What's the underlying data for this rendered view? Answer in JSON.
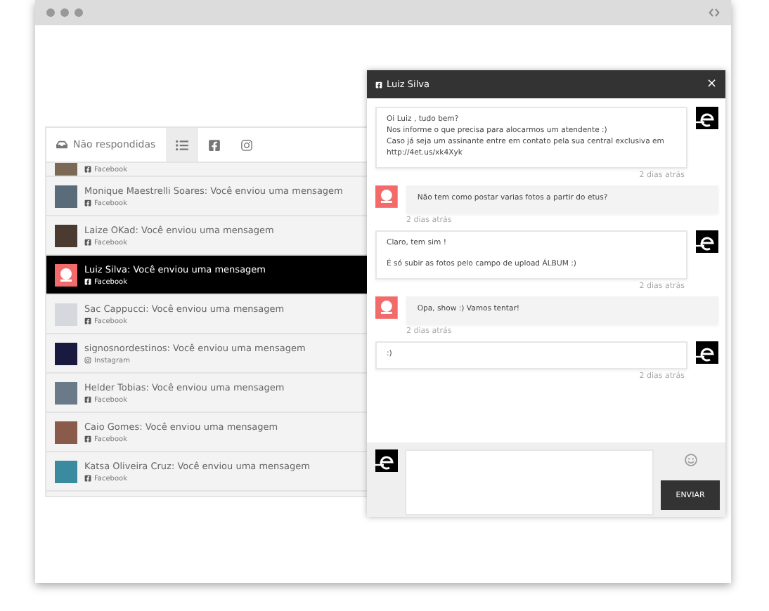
{
  "tabs": [
    {
      "kind": "inbox",
      "label": "Não respondidas",
      "selected": false
    },
    {
      "kind": "list",
      "selected": true
    },
    {
      "kind": "facebook",
      "selected": false
    },
    {
      "kind": "instagram",
      "selected": false
    }
  ],
  "conversations": [
    {
      "avatar": {
        "kind": "photo"
      },
      "source": {
        "kind": "facebook",
        "label": "Facebook"
      },
      "selected": false
    },
    {
      "avatar": {
        "kind": "photo"
      },
      "title": "Monique Maestrelli Soares: Você enviou uma mensagem",
      "source": {
        "kind": "facebook",
        "label": "Facebook"
      },
      "selected": false
    },
    {
      "avatar": {
        "kind": "photo"
      },
      "title": "Laize OKad: Você enviou uma mensagem",
      "source": {
        "kind": "facebook",
        "label": "Facebook"
      },
      "selected": false
    },
    {
      "avatar": {
        "kind": "logo"
      },
      "title": "Luiz Silva: Você enviou uma mensagem",
      "source": {
        "kind": "facebook",
        "label": "Facebook"
      },
      "selected": true
    },
    {
      "avatar": {
        "kind": "blank"
      },
      "title": "Sac Cappucci: Você enviou uma mensagem",
      "source": {
        "kind": "facebook",
        "label": "Facebook"
      },
      "selected": false
    },
    {
      "avatar": {
        "kind": "photo"
      },
      "title": "signosnordestinos: Você enviou uma mensagem",
      "source": {
        "kind": "instagram",
        "label": "Instagram"
      },
      "selected": false
    },
    {
      "avatar": {
        "kind": "photo"
      },
      "title": "Helder Tobias: Você enviou uma mensagem",
      "source": {
        "kind": "facebook",
        "label": "Facebook"
      },
      "selected": false
    },
    {
      "avatar": {
        "kind": "photo"
      },
      "title": "Caio Gomes: Você enviou uma mensagem",
      "source": {
        "kind": "facebook",
        "label": "Facebook"
      },
      "selected": false
    },
    {
      "avatar": {
        "kind": "photo"
      },
      "title": "Katsa Oliveira Cruz: Você enviou uma mensagem",
      "source": {
        "kind": "facebook",
        "label": "Facebook"
      },
      "selected": false
    }
  ],
  "chat": {
    "title": "Luiz Silva",
    "network": {
      "kind": "facebook"
    },
    "close": "×",
    "messages": [
      {
        "kind": "agent",
        "paragraphs": [
          [
            "Oi Luiz , tudo bem?",
            "Nos informe o que precisa para alocarmos um atendente :)",
            "Caso já seja um assinante entre em contato pela sua central exclusiva em",
            "http://4et.us/xk4Xyk"
          ]
        ],
        "time": "2 dias atrás"
      },
      {
        "kind": "customer",
        "paragraphs": [
          [
            "Não tem como postar varias fotos a partir do etus?"
          ]
        ],
        "time": "2 dias atrás"
      },
      {
        "kind": "agent",
        "paragraphs": [
          [
            "Claro, tem sim !"
          ],
          [
            "É só subir as fotos pelo campo de upload ÁLBUM :)"
          ]
        ],
        "time": "2 dias atrás"
      },
      {
        "kind": "customer",
        "paragraphs": [
          [
            "Opa, show :) Vamos tentar!"
          ]
        ],
        "time": "2 dias atrás"
      },
      {
        "kind": "agent",
        "paragraphs": [
          [
            ":)"
          ]
        ],
        "time": "2 dias atrás"
      }
    ],
    "send": "ENVIAR"
  }
}
